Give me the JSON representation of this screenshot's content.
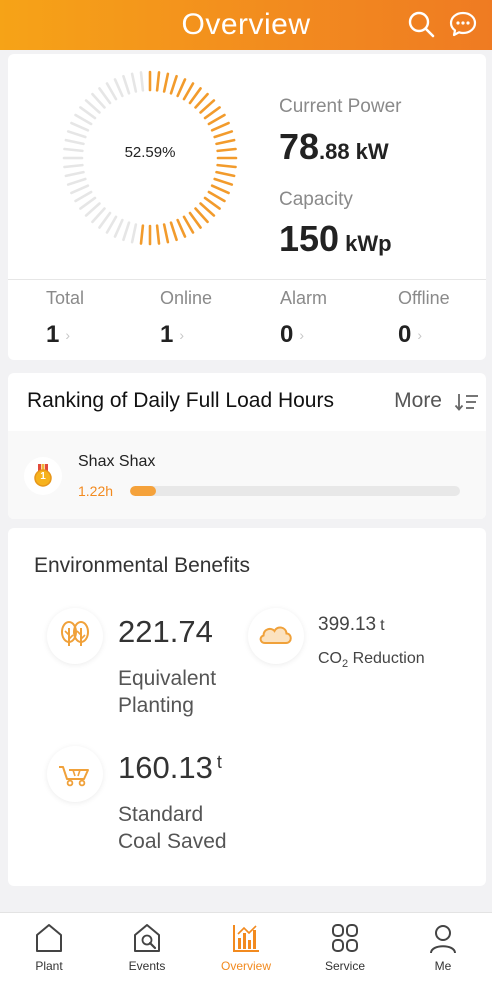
{
  "header": {
    "title": "Overview",
    "search_icon": "search-icon",
    "message_icon": "chat-bubble-icon",
    "gradient_start": "#f6a317",
    "gradient_end": "#ef7b22"
  },
  "power": {
    "percent_label": "52.59%",
    "percent_value": 0.5259,
    "current_power_label": "Current Power",
    "current_power_int": "78",
    "current_power_dec": ".88",
    "current_power_unit": "kW",
    "capacity_label": "Capacity",
    "capacity_value": "150",
    "capacity_unit": "kWp",
    "accent_color": "#f29b2c"
  },
  "stats": [
    {
      "label": "Total",
      "value": "1",
      "chevron": "›"
    },
    {
      "label": "Online",
      "value": "1",
      "chevron": "›"
    },
    {
      "label": "Alarm",
      "value": "0",
      "chevron": "›"
    },
    {
      "label": "Offline",
      "value": "0",
      "chevron": "›"
    }
  ],
  "ranking": {
    "title": "Ranking of Daily Full Load Hours",
    "more_label": "More",
    "sort_icon": "sort-icon",
    "items": [
      {
        "name": "Shax Shax",
        "hours": "1.22h",
        "progress": 0.08,
        "medal_icon": "gold-medal-icon",
        "medal_number": "1"
      }
    ]
  },
  "env": {
    "title": "Environmental Benefits",
    "planting_value": "221.74",
    "planting_label_line1": "Equivalent",
    "planting_label_line2": "Planting",
    "co2_value": "399.13",
    "co2_unit": "t",
    "co2_label_prefix": "CO",
    "co2_label_sub": "2",
    "co2_label_suffix": " Reduction",
    "coal_value": "160.13",
    "coal_unit": "t",
    "coal_label_line1": "Standard",
    "coal_label_line2": "Coal Saved"
  },
  "tabs": [
    {
      "label": "Plant",
      "icon": "home-icon",
      "active": false
    },
    {
      "label": "Events",
      "icon": "house-wrench-icon",
      "active": false
    },
    {
      "label": "Overview",
      "icon": "bar-chart-icon",
      "active": true
    },
    {
      "label": "Service",
      "icon": "grid-icon",
      "active": false
    },
    {
      "label": "Me",
      "icon": "person-icon",
      "active": false
    }
  ]
}
